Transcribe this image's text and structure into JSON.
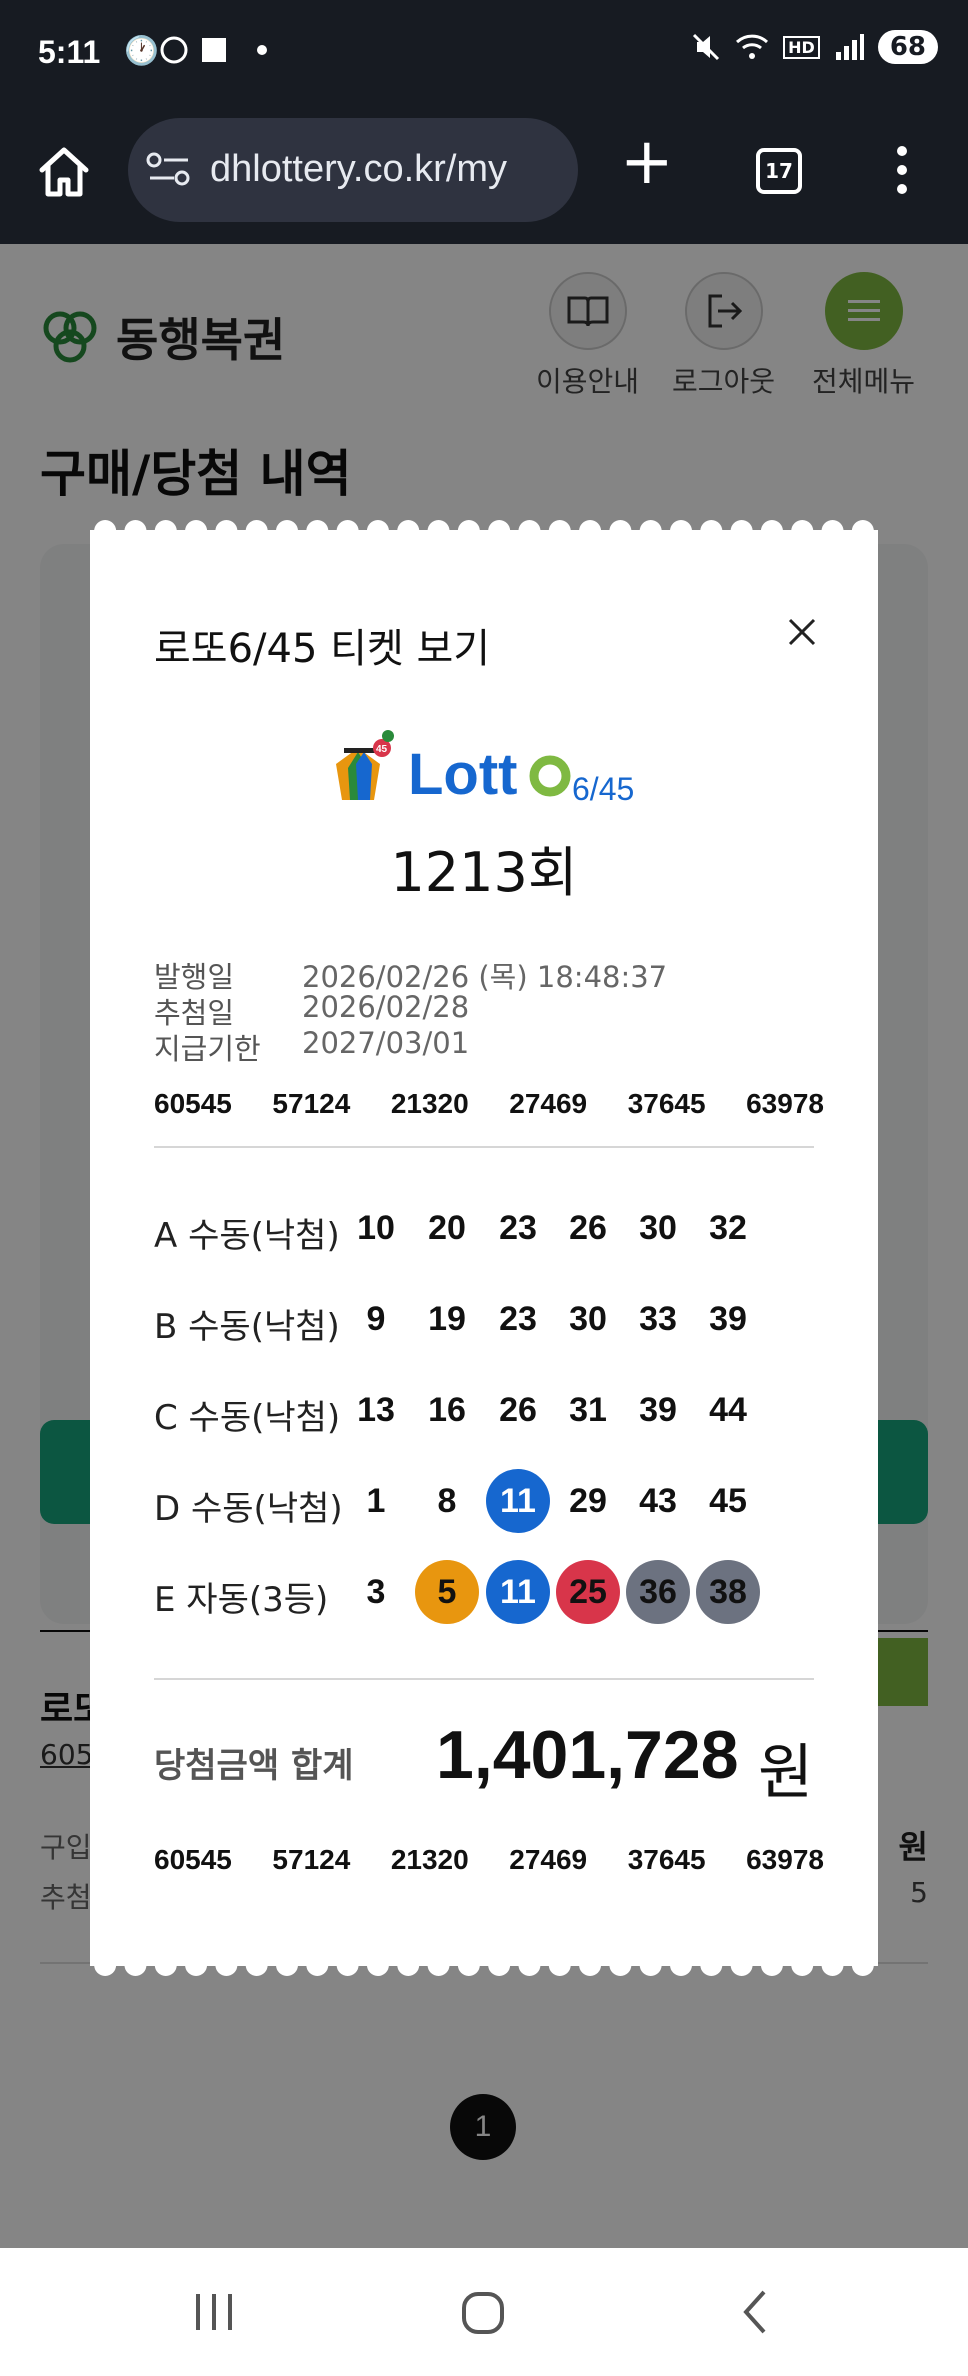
{
  "status_bar": {
    "time": "5:11",
    "battery": "68",
    "network": "HD"
  },
  "browser": {
    "url": "dhlottery.co.kr/my",
    "tab_count": "17"
  },
  "page": {
    "brand": "동행복권",
    "nav": [
      {
        "label": "이용안내",
        "icon": "guide-book-icon"
      },
      {
        "label": "로그아웃",
        "icon": "logout-icon"
      },
      {
        "label": "전체메뉴",
        "icon": "menu-icon"
      }
    ],
    "title": "구매/당첨 내역",
    "result": {
      "title": "로또",
      "sub": "605",
      "label_a": "구입",
      "label_b": "추첨",
      "value_a": "원",
      "value_b": "5"
    },
    "pagination": {
      "current": "1"
    }
  },
  "modal": {
    "title": "로또6/45 티켓 보기",
    "logo_text": "Lotto6/45",
    "round": "1213회",
    "issue_label": "발행일",
    "issue_value": "2026/02/26 (목) 18:48:37",
    "draw_label": "추첨일",
    "draw_value": "2026/02/28",
    "deadline_label": "지급기한",
    "deadline_value": "2027/03/01",
    "serial": [
      "60545",
      "57124",
      "21320",
      "27469",
      "37645",
      "63978"
    ],
    "games": [
      {
        "label": "A 수동(낙첨)",
        "numbers": [
          "10",
          "20",
          "23",
          "26",
          "30",
          "32"
        ],
        "highlight": [
          "",
          "",
          "",
          "",
          "",
          ""
        ]
      },
      {
        "label": "B 수동(낙첨)",
        "numbers": [
          "9",
          "19",
          "23",
          "30",
          "33",
          "39"
        ],
        "highlight": [
          "",
          "",
          "",
          "",
          "",
          ""
        ]
      },
      {
        "label": "C 수동(낙첨)",
        "numbers": [
          "13",
          "16",
          "26",
          "31",
          "39",
          "44"
        ],
        "highlight": [
          "",
          "",
          "",
          "",
          "",
          ""
        ]
      },
      {
        "label": "D 수동(낙첨)",
        "numbers": [
          "1",
          "8",
          "11",
          "29",
          "43",
          "45"
        ],
        "highlight": [
          "",
          "",
          "blue",
          "",
          "",
          ""
        ]
      },
      {
        "label": "E 자동(3등)",
        "numbers": [
          "3",
          "5",
          "11",
          "25",
          "36",
          "38"
        ],
        "highlight": [
          "",
          "yellow",
          "blue",
          "red",
          "gray",
          "gray"
        ]
      }
    ],
    "prize_label": "당첨금액 합계",
    "prize_amount": "1,401,728",
    "prize_unit": "원",
    "close_icon": "close-icon"
  },
  "colors": {
    "brand_green": "#18a67e",
    "ball_yellow": "#e8960f",
    "ball_blue": "#1667cf",
    "ball_red": "#d8354a",
    "ball_gray": "#6c7280"
  }
}
